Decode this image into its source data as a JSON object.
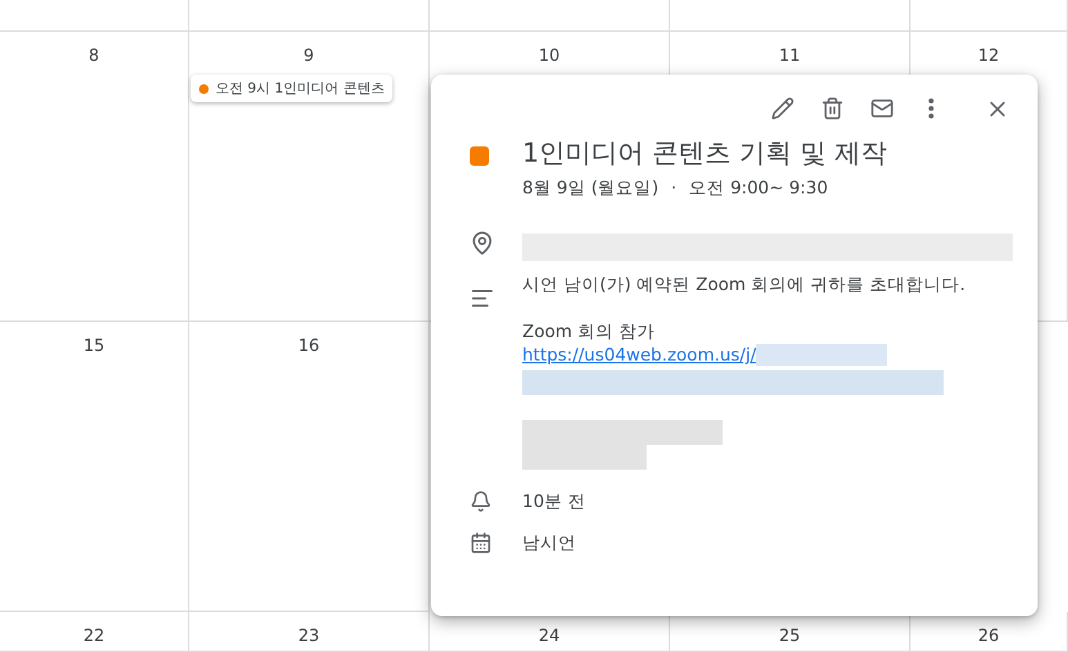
{
  "calendar": {
    "weeks": [
      {
        "days": [
          {
            "date": "8"
          },
          {
            "date": "9",
            "events": [
              {
                "label": "오전 9시 1인미디어 콘텐츠",
                "color": "#f57c00"
              }
            ]
          },
          {
            "date": "10"
          },
          {
            "date": "11"
          },
          {
            "date": "12"
          }
        ]
      },
      {
        "days": [
          {
            "date": "15"
          },
          {
            "date": "16"
          }
        ]
      },
      {
        "days": [
          {
            "date": "22"
          },
          {
            "date": "23"
          },
          {
            "date": "24"
          },
          {
            "date": "25"
          },
          {
            "date": "26"
          }
        ]
      }
    ]
  },
  "popup": {
    "title": "1인미디어 콘텐츠 기획 및 제작",
    "color": "#f57c00",
    "date": "8월 9일 (월요일)",
    "separator": "·",
    "time": "오전 9:00~ 9:30",
    "description": [
      {
        "kind": "text",
        "text": "시언 남이(가) 예약된 Zoom 회의에 귀하를 초대합니다."
      },
      {
        "kind": "gap"
      },
      {
        "kind": "text",
        "text": "Zoom 회의 참가"
      },
      {
        "kind": "link",
        "text": "https://us04web.zoom.us/j/"
      }
    ],
    "reminder": "10분 전",
    "calendar_name": "남시언"
  }
}
